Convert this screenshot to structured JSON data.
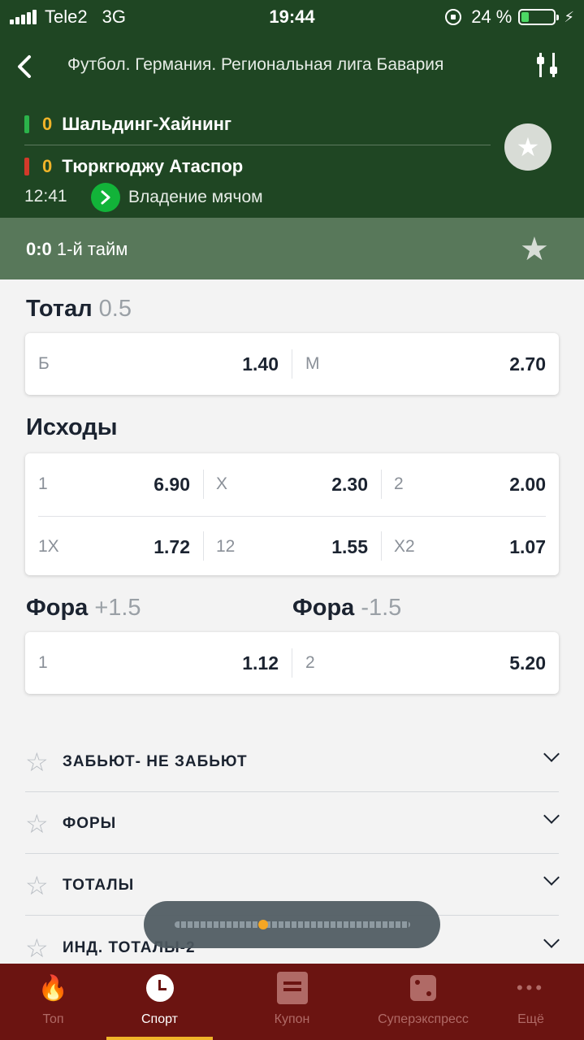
{
  "status_bar": {
    "carrier": "Tele2",
    "network": "3G",
    "time": "19:44",
    "battery": "24 %",
    "battery_level": 0.24
  },
  "header": {
    "league": "Футбол. Германия. Региональная лига Бавария",
    "team1": {
      "name": "Шальдинг-Хайнинг",
      "score": "0",
      "flag_color": "#2bb34a"
    },
    "team2": {
      "name": "Тюркгюджу Атаспор",
      "score": "0",
      "flag_color": "#d23a2a"
    },
    "match_time": "12:41",
    "event": "Владение мячом",
    "score_line": "0:0",
    "period": "1-й тайм"
  },
  "markets": {
    "total": {
      "title": "Тотал",
      "param": "0.5",
      "odds": [
        {
          "label": "Б",
          "value": "1.40"
        },
        {
          "label": "М",
          "value": "2.70"
        }
      ]
    },
    "outcomes": {
      "title": "Исходы",
      "row1": [
        {
          "label": "1",
          "value": "6.90"
        },
        {
          "label": "X",
          "value": "2.30"
        },
        {
          "label": "2",
          "value": "2.00"
        }
      ],
      "row2": [
        {
          "label": "1X",
          "value": "1.72"
        },
        {
          "label": "12",
          "value": "1.55"
        },
        {
          "label": "X2",
          "value": "1.07"
        }
      ]
    },
    "handicap": {
      "title1": "Фора",
      "param1": "+1.5",
      "title2": "Фора",
      "param2": "-1.5",
      "odds": [
        {
          "label": "1",
          "value": "1.12"
        },
        {
          "label": "2",
          "value": "5.20"
        }
      ]
    }
  },
  "accordion": [
    {
      "title": "ЗАБЬЮТ- НЕ ЗАБЬЮТ"
    },
    {
      "title": "ФОРЫ"
    },
    {
      "title": "ТОТАЛЫ"
    },
    {
      "title": "ИНД. ТОТАЛЫ-2"
    }
  ],
  "tabbar": {
    "tabs": [
      {
        "label": "Топ",
        "icon": "flame-icon"
      },
      {
        "label": "Спорт",
        "icon": "clock-icon"
      },
      {
        "label": "Купон",
        "icon": "coupon-icon"
      },
      {
        "label": "Суперэкспресс",
        "icon": "dice-icon"
      },
      {
        "label": "Ещё",
        "icon": "more-icon"
      }
    ],
    "active_index": 1
  },
  "colors": {
    "header_bg": "#1f4623",
    "subheader_bg": "#58785a",
    "tabbar_bg": "#6b1411",
    "accent": "#f0b429",
    "event_green": "#12b339"
  }
}
